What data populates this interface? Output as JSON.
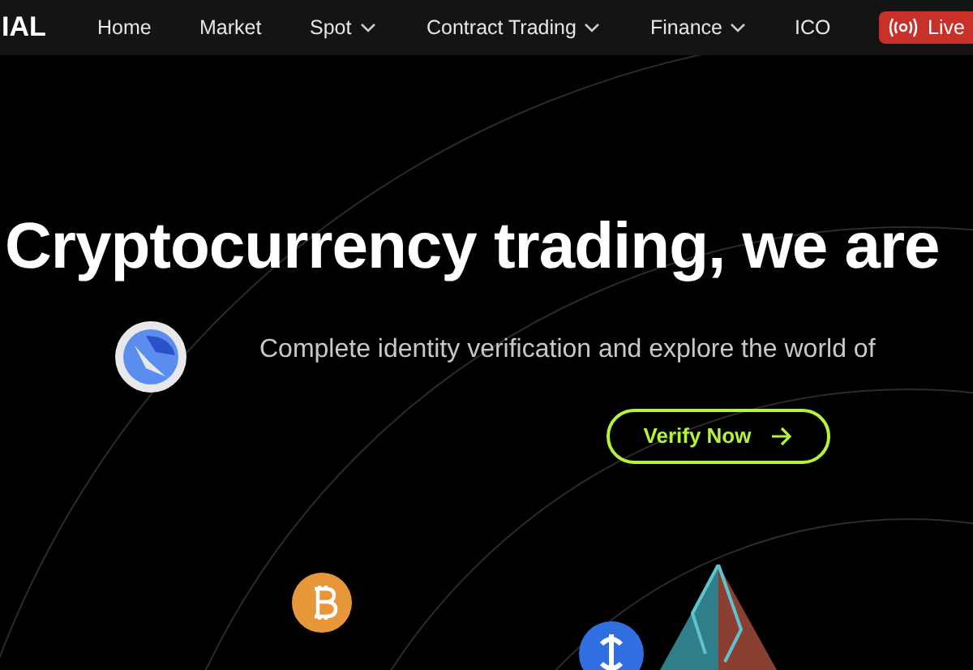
{
  "brand": "IAL",
  "nav": [
    {
      "label": "Home",
      "dropdown": false
    },
    {
      "label": "Market",
      "dropdown": false
    },
    {
      "label": "Spot",
      "dropdown": true
    },
    {
      "label": "Contract Trading",
      "dropdown": true
    },
    {
      "label": "Finance",
      "dropdown": true
    },
    {
      "label": "ICO",
      "dropdown": false
    }
  ],
  "live_button": "Live",
  "hero": {
    "headline": "Cryptocurrency trading, we are",
    "subtitle": "Complete identity verification and explore the world of",
    "cta": "Verify Now"
  }
}
